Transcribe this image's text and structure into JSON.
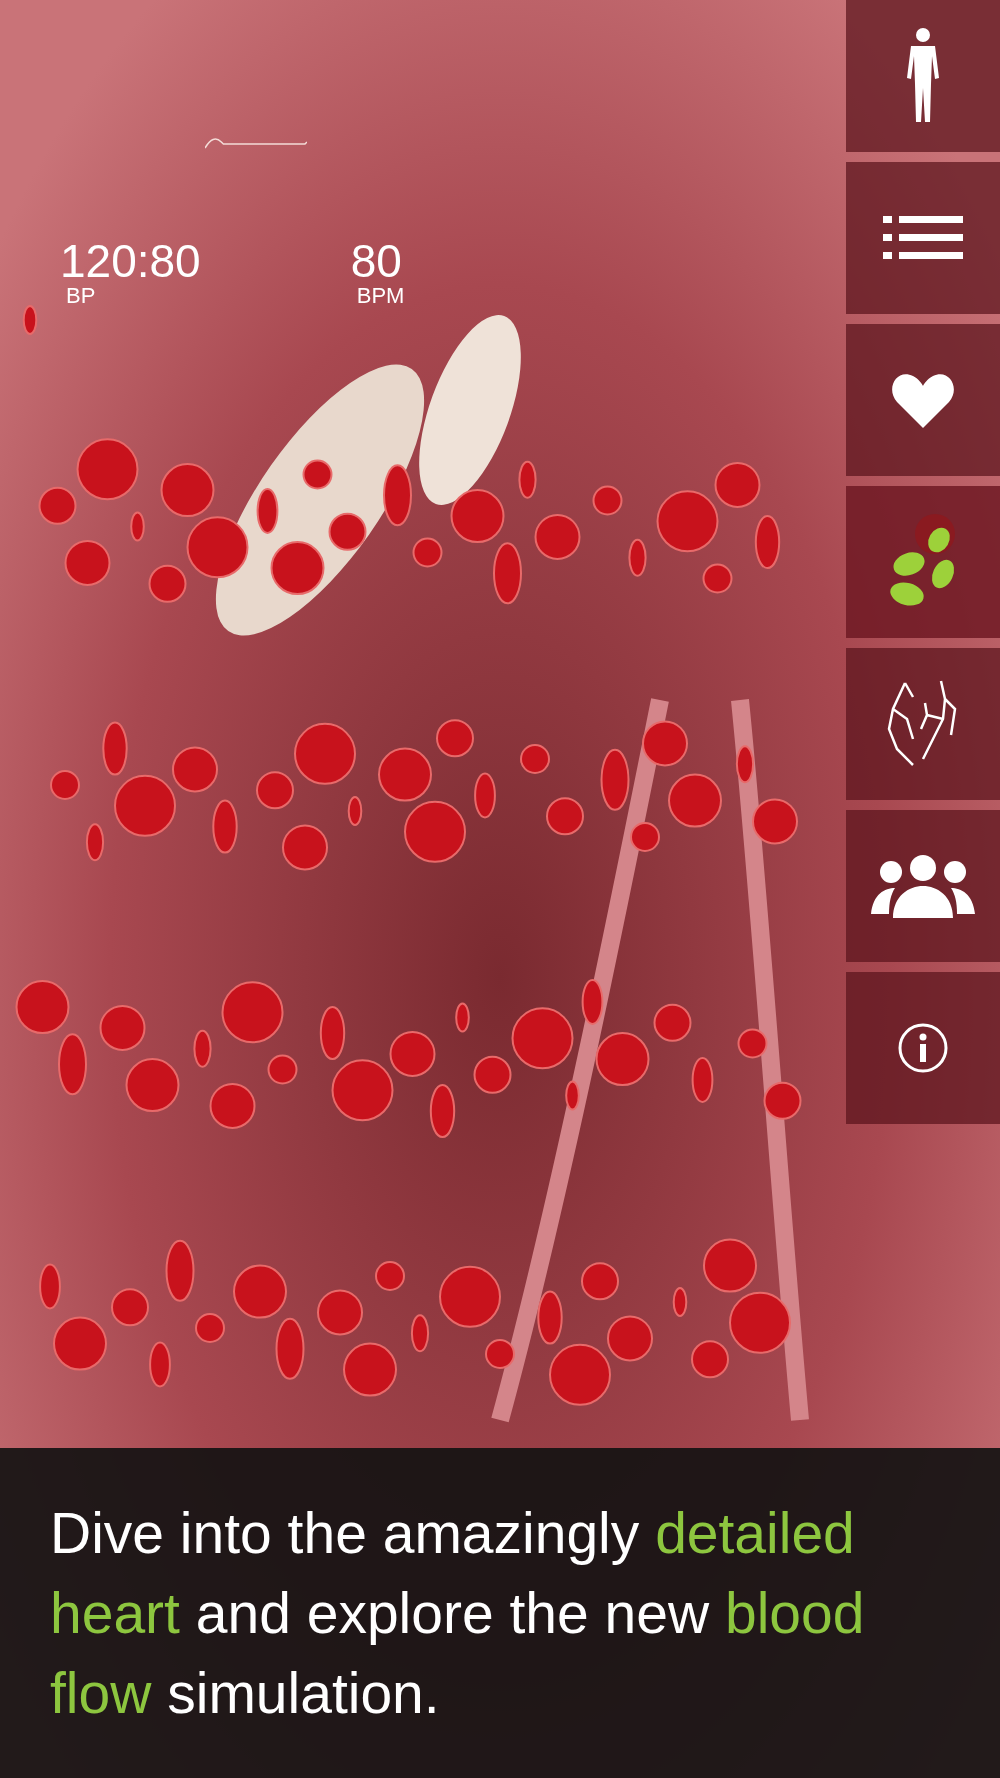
{
  "vitals": [
    {
      "value": "120:80",
      "unit": "BP"
    },
    {
      "value": "80",
      "unit": "BPM"
    }
  ],
  "sidebar": {
    "items": [
      {
        "kind": "body",
        "selected": false
      },
      {
        "kind": "list",
        "selected": false
      },
      {
        "kind": "heart",
        "selected": false
      },
      {
        "kind": "cells",
        "selected": true
      },
      {
        "kind": "vessels",
        "selected": false
      },
      {
        "kind": "people",
        "selected": false
      },
      {
        "kind": "info",
        "selected": false
      }
    ]
  },
  "caption": {
    "segments": [
      {
        "text": "Dive into the amazingly ",
        "highlight": false
      },
      {
        "text": "detailed heart",
        "highlight": true
      },
      {
        "text": " and explore the new ",
        "highlight": false
      },
      {
        "text": "blood flow",
        "highlight": true
      },
      {
        "text": " simulation.",
        "highlight": false
      }
    ]
  }
}
